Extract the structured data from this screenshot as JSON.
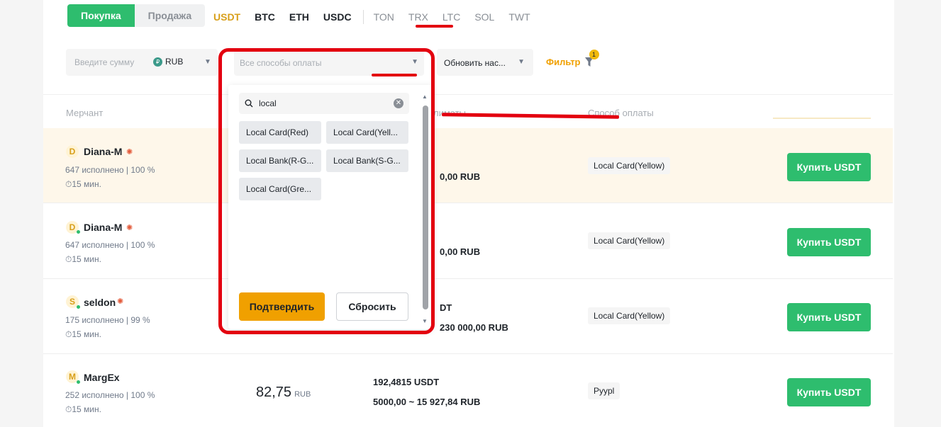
{
  "tabs": {
    "buy": "Покупка",
    "sell": "Продажа"
  },
  "coins": [
    "USDT",
    "BTC",
    "ETH",
    "USDC"
  ],
  "coins_more": [
    "TON",
    "TRX",
    "LTC",
    "SOL",
    "TWT"
  ],
  "filters": {
    "amount_placeholder": "Введите сумму",
    "currency": "RUB",
    "currency_icon": "₽",
    "payment_placeholder": "Все способы оплаты",
    "refresh": "Обновить нас...",
    "filter_label": "Фильтр",
    "filter_count": "1"
  },
  "header": {
    "merchant": "Мерчант",
    "limits": "лиматы",
    "payment": "Способ оплаты"
  },
  "rows": [
    {
      "initial": "D",
      "name": "Diana-M",
      "stats": "647 исполнено  |  100 %",
      "time": "15 мин.",
      "limit": "0,00 RUB",
      "method": "Local Card(Yellow)",
      "action": "Купить USDT"
    },
    {
      "initial": "D",
      "name": "Diana-M",
      "stats": "647 исполнено  |  100 %",
      "time": "15 мин.",
      "limit": "0,00 RUB",
      "method": "Local Card(Yellow)",
      "action": "Купить USDT"
    },
    {
      "initial": "S",
      "name": "seldon",
      "stats": "175 исполнено  |  99 %",
      "time": "15 мин.",
      "avail": "DT",
      "limit": "230 000,00 RUB",
      "method": "Local Card(Yellow)",
      "action": "Купить USDT"
    },
    {
      "initial": "M",
      "name": "MargEx",
      "stats": "252 исполнено  |  100 %",
      "time": "15 мин.",
      "price": "82,75",
      "price_cur": "RUB",
      "avail": "192,4815 USDT",
      "limit": "5000,00 ~ 15 927,84 RUB",
      "method": "Pyypl",
      "action": "Купить USDT"
    }
  ],
  "dropdown": {
    "search_value": "local",
    "options": [
      "Local Card(Red)",
      "Local Card(Yell...",
      "Local Bank(R-G...",
      "Local Bank(S-G...",
      "Local Card(Gre..."
    ],
    "confirm": "Подтвердить",
    "reset": "Сбросить"
  },
  "colors": {
    "accent": "#f0a000",
    "buy": "#2ebd6e",
    "annotation": "#e3000f"
  }
}
